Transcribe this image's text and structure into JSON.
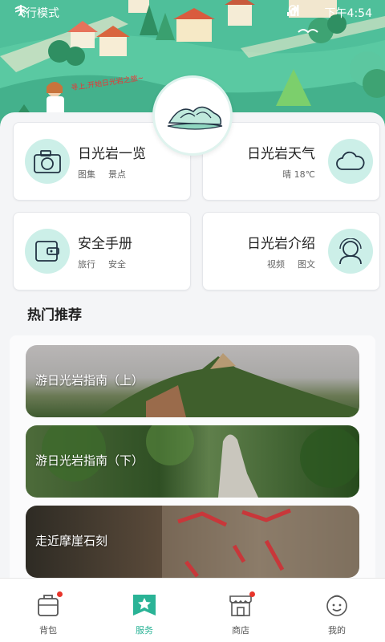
{
  "status_bar": {
    "left_text": "飞行模式",
    "icons_left": [
      "wifi-icon",
      "airplane-icon"
    ],
    "icons_right": [
      "location-icon",
      "signal-icon"
    ],
    "time_text": "下午4:54"
  },
  "hero": {
    "speech_text": "寻上,开始日光岩之旅~"
  },
  "cards": [
    {
      "title": "日光岩一览",
      "tags": [
        "图集",
        "景点"
      ],
      "icon": "camera-icon"
    },
    {
      "title": "日光岩天气",
      "tags": [
        "晴 18℃"
      ],
      "icon": "cloud-icon"
    },
    {
      "title": "安全手册",
      "tags": [
        "旅行",
        "安全"
      ],
      "icon": "wallet-icon"
    },
    {
      "title": "日光岩介绍",
      "tags": [
        "视频",
        "图文"
      ],
      "icon": "person-icon"
    }
  ],
  "section": {
    "title": "热门推荐"
  },
  "recommendations": [
    {
      "label": "游日光岩指南（上）"
    },
    {
      "label": "游日光岩指南（下）"
    },
    {
      "label": "走近摩崖石刻"
    }
  ],
  "bottom_nav": [
    {
      "label": "背包",
      "icon": "backpack-icon",
      "badge": true,
      "active": false
    },
    {
      "label": "服务",
      "icon": "service-icon",
      "badge": false,
      "active": true
    },
    {
      "label": "商店",
      "icon": "shop-icon",
      "badge": true,
      "active": false
    },
    {
      "label": "我的",
      "icon": "profile-icon",
      "badge": false,
      "active": false
    }
  ],
  "colors": {
    "accent": "#2ab396",
    "hero_green": "#4fbf9a",
    "icon_bg": "#ccefe8",
    "badge_red": "#e8352b"
  }
}
